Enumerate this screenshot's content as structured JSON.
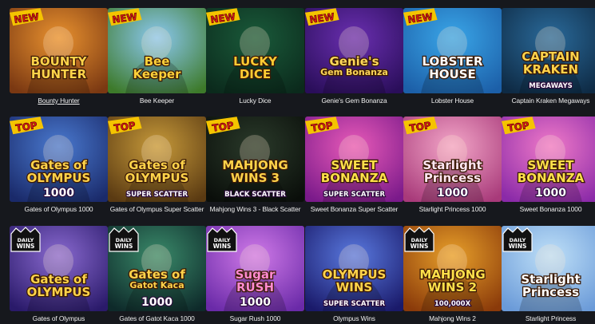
{
  "games": [
    {
      "name": "Bounty Hunter",
      "badge": "NEW",
      "title_lines": [
        "BOUNTY",
        "HUNTER"
      ],
      "sub": "",
      "bg1": "#e9922f",
      "bg2": "#7a3812",
      "title_color": "#ffd34a",
      "hovered": true
    },
    {
      "name": "Bee Keeper",
      "badge": "NEW",
      "title_lines": [
        "Bee",
        "Keeper"
      ],
      "sub": "",
      "bg1": "#8bc8f0",
      "bg2": "#3d7a2a",
      "title_color": "#ffd23a",
      "hovered": false
    },
    {
      "name": "Lucky Dice",
      "badge": "NEW",
      "title_lines": [
        "LUCKY",
        "DICE"
      ],
      "sub": "",
      "bg1": "#1a5a3a",
      "bg2": "#0b2a1c",
      "title_color": "#ffcc33",
      "hovered": false
    },
    {
      "name": "Genie's Gem Bonanza",
      "badge": "NEW",
      "title_lines": [
        "Genie's",
        "Gem Bonanza"
      ],
      "sub": "",
      "bg1": "#6a2fb0",
      "bg2": "#2a0e5a",
      "title_color": "#ffd85a",
      "hovered": false
    },
    {
      "name": "Lobster House",
      "badge": "NEW",
      "title_lines": [
        "LOBSTER",
        "HOUSE"
      ],
      "sub": "",
      "bg1": "#3aa6e8",
      "bg2": "#1c5fa8",
      "title_color": "#ffffff",
      "hovered": false
    },
    {
      "name": "Captain Kraken Megaways",
      "badge": "",
      "title_lines": [
        "CAPTAIN",
        "KRAKEN"
      ],
      "sub": "MEGAWAYS",
      "bg1": "#2a6a9a",
      "bg2": "#0e2a44",
      "title_color": "#ffd24a",
      "hovered": false
    },
    {
      "name": "Gates of Olympus 1000",
      "badge": "TOP",
      "title_lines": [
        "Gates of",
        "OLYMPUS"
      ],
      "sub": "1000",
      "bg1": "#4a7ad0",
      "bg2": "#1a2a6a",
      "title_color": "#ffd34a",
      "hovered": false
    },
    {
      "name": "Gates of Olympus Super Scatter",
      "badge": "TOP",
      "title_lines": [
        "Gates of",
        "OLYMPUS"
      ],
      "sub": "SUPER SCATTER",
      "bg1": "#c79a3a",
      "bg2": "#5a3a12",
      "title_color": "#ffd34a",
      "hovered": false
    },
    {
      "name": "Mahjong Wins 3 - Black Scatter",
      "badge": "TOP",
      "title_lines": [
        "MAHJONG",
        "WINS 3"
      ],
      "sub": "BLACK SCATTER",
      "bg1": "#2a3a2a",
      "bg2": "#0a0e0a",
      "title_color": "#ffd34a",
      "hovered": false
    },
    {
      "name": "Sweet Bonanza Super Scatter",
      "badge": "TOP",
      "title_lines": [
        "SWEET",
        "BONANZA"
      ],
      "sub": "SUPER SCATTER",
      "bg1": "#e85ab8",
      "bg2": "#7a1a8a",
      "title_color": "#ffe04a",
      "hovered": false
    },
    {
      "name": "Starlight Princess 1000",
      "badge": "TOP",
      "title_lines": [
        "Starlight",
        "Princess"
      ],
      "sub": "1000",
      "bg1": "#f3a6c8",
      "bg2": "#a83a7a",
      "title_color": "#ffe6f2",
      "hovered": false
    },
    {
      "name": "Sweet Bonanza 1000",
      "badge": "TOP",
      "title_lines": [
        "SWEET",
        "BONANZA"
      ],
      "sub": "1000",
      "bg1": "#f07ac8",
      "bg2": "#8a2aa8",
      "title_color": "#ffe04a",
      "hovered": false
    },
    {
      "name": "Gates of Olympus",
      "badge": "DAILY WINS",
      "title_lines": [
        "Gates of",
        "OLYMPUS"
      ],
      "sub": "",
      "bg1": "#8a6ad0",
      "bg2": "#2a1a6a",
      "title_color": "#ffd34a",
      "hovered": false
    },
    {
      "name": "Gates of Gatot Kaca 1000",
      "badge": "DAILY WINS",
      "title_lines": [
        "Gates of",
        "Gatot Kaca"
      ],
      "sub": "1000",
      "bg1": "#3a8a6a",
      "bg2": "#0e2a2a",
      "title_color": "#ffd34a",
      "hovered": false
    },
    {
      "name": "Sugar Rush 1000",
      "badge": "DAILY WINS",
      "title_lines": [
        "Sugar",
        "RUSH"
      ],
      "sub": "1000",
      "bg1": "#d07ae8",
      "bg2": "#6a2aa8",
      "title_color": "#ff8ad0",
      "hovered": false
    },
    {
      "name": "Olympus Wins",
      "badge": "",
      "title_lines": [
        "OLYMPUS",
        "WINS"
      ],
      "sub": "SUPER SCATTER",
      "bg1": "#5a7ae0",
      "bg2": "#1a1a6a",
      "title_color": "#ffd34a",
      "hovered": false
    },
    {
      "name": "Mahjong Wins 2",
      "badge": "DAILY WINS",
      "title_lines": [
        "MAHJONG",
        "WINS 2"
      ],
      "sub": "100,000X",
      "bg1": "#e8a02a",
      "bg2": "#8a3a0a",
      "title_color": "#ffe04a",
      "hovered": false
    },
    {
      "name": "Starlight Princess",
      "badge": "DAILY WINS",
      "title_lines": [
        "Starlight",
        "Princess"
      ],
      "sub": "",
      "bg1": "#bfe0f8",
      "bg2": "#6a9ad8",
      "title_color": "#ffffff",
      "hovered": false
    }
  ]
}
